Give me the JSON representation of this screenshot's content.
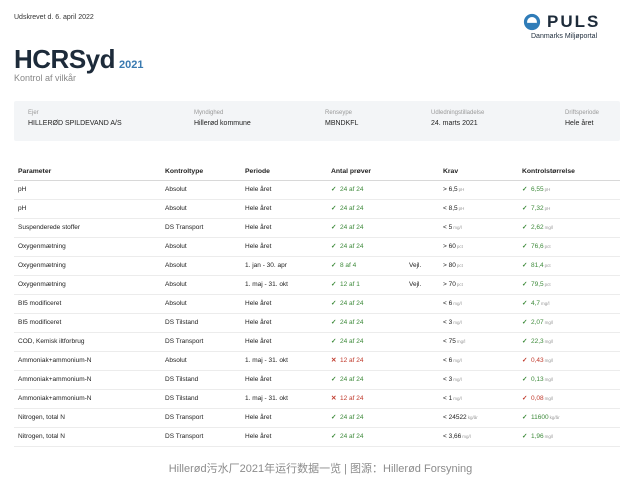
{
  "printed_date": "Udskrevet d. 6. april 2022",
  "brand": {
    "name": "PULS",
    "tagline": "Danmarks Miljøportal",
    "accent": "#3a7ab0"
  },
  "report": {
    "title": "HCRSyd",
    "year": "2021",
    "subtitle": "Kontrol af vilkår"
  },
  "info": [
    {
      "label": "Ejer",
      "value": "HILLERØD SPILDEVAND A/S"
    },
    {
      "label": "Myndighed",
      "value": "Hillerød kommune"
    },
    {
      "label": "Renseype",
      "value": "MBNDKFL"
    },
    {
      "label": "Udledningstilladelse",
      "value": "24. marts 2021"
    },
    {
      "label": "Driftsperiode",
      "value": "Hele året"
    }
  ],
  "columns": [
    "Parameter",
    "Kontroltype",
    "Periode",
    "Antal prøver",
    "",
    "Krav",
    "Kontrolstørrelse"
  ],
  "rows": [
    {
      "param": "pH",
      "type": "Absolut",
      "period": "Hele året",
      "count": "24 af 24",
      "status": "ok",
      "note": "",
      "krav": "> 6,5",
      "krav_unit": "pH",
      "value": "6,55",
      "value_unit": "pH"
    },
    {
      "param": "pH",
      "type": "Absolut",
      "period": "Hele året",
      "count": "24 af 24",
      "status": "ok",
      "note": "",
      "krav": "< 8,5",
      "krav_unit": "pH",
      "value": "7,32",
      "value_unit": "pH"
    },
    {
      "param": "Suspenderede stoffer",
      "type": "DS Transport",
      "period": "Hele året",
      "count": "24 af 24",
      "status": "ok",
      "note": "",
      "krav": "< 5",
      "krav_unit": "mg/l",
      "value": "2,62",
      "value_unit": "mg/l"
    },
    {
      "param": "Oxygenmætning",
      "type": "Absolut",
      "period": "Hele året",
      "count": "24 af 24",
      "status": "ok",
      "note": "",
      "krav": "> 60",
      "krav_unit": "pct",
      "value": "76,6",
      "value_unit": "pct"
    },
    {
      "param": "Oxygenmætning",
      "type": "Absolut",
      "period": "1. jan - 30. apr",
      "count": "8 af 4",
      "status": "ok",
      "note": "Vejl.",
      "krav": "> 80",
      "krav_unit": "pct",
      "value": "81,4",
      "value_unit": "pct"
    },
    {
      "param": "Oxygenmætning",
      "type": "Absolut",
      "period": "1. maj - 31. okt",
      "count": "12 af 1",
      "status": "ok",
      "note": "Vejl.",
      "krav": "> 70",
      "krav_unit": "pct",
      "value": "79,5",
      "value_unit": "pct"
    },
    {
      "param": "BI5 modificeret",
      "type": "Absolut",
      "period": "Hele året",
      "count": "24 af 24",
      "status": "ok",
      "note": "",
      "krav": "< 6",
      "krav_unit": "mg/l",
      "value": "4,7",
      "value_unit": "mg/l"
    },
    {
      "param": "BI5 modificeret",
      "type": "DS Tilstand",
      "period": "Hele året",
      "count": "24 af 24",
      "status": "ok",
      "note": "",
      "krav": "< 3",
      "krav_unit": "mg/l",
      "value": "2,07",
      "value_unit": "mg/l"
    },
    {
      "param": "COD, Kemisk iltforbrug",
      "type": "DS Transport",
      "period": "Hele året",
      "count": "24 af 24",
      "status": "ok",
      "note": "",
      "krav": "< 75",
      "krav_unit": "mg/l",
      "value": "22,3",
      "value_unit": "mg/l"
    },
    {
      "param": "Ammoniak+ammonium-N",
      "type": "Absolut",
      "period": "1. maj - 31. okt",
      "count": "12 af 24",
      "status": "bad",
      "note": "",
      "krav": "< 6",
      "krav_unit": "mg/l",
      "value": "0,43",
      "value_unit": "mg/l"
    },
    {
      "param": "Ammoniak+ammonium-N",
      "type": "DS Tilstand",
      "period": "Hele året",
      "count": "24 af 24",
      "status": "ok",
      "note": "",
      "krav": "< 3",
      "krav_unit": "mg/l",
      "value": "0,13",
      "value_unit": "mg/l"
    },
    {
      "param": "Ammoniak+ammonium-N",
      "type": "DS Tilstand",
      "period": "1. maj - 31. okt",
      "count": "12 af 24",
      "status": "bad",
      "note": "",
      "krav": "< 1",
      "krav_unit": "mg/l",
      "value": "0,08",
      "value_unit": "mg/l"
    },
    {
      "param": "Nitrogen, total N",
      "type": "DS Transport",
      "period": "Hele året",
      "count": "24 af 24",
      "status": "ok",
      "note": "",
      "krav": "< 24522",
      "krav_unit": "kg/år",
      "value": "11600",
      "value_unit": "kg/år"
    },
    {
      "param": "Nitrogen, total N",
      "type": "DS Transport",
      "period": "Hele året",
      "count": "24 af 24",
      "status": "ok",
      "note": "",
      "krav": "< 3,66",
      "krav_unit": "mg/l",
      "value": "1,96",
      "value_unit": "mg/l"
    }
  ],
  "colors": {
    "ok": "#3d8a3a",
    "bad": "#c0392b",
    "title": "#1d2b3a",
    "infobar": "#f3f5f7"
  },
  "caption": "Hillerød污水厂2021年运行数据一览 | 图源：Hillerød Forsyning"
}
